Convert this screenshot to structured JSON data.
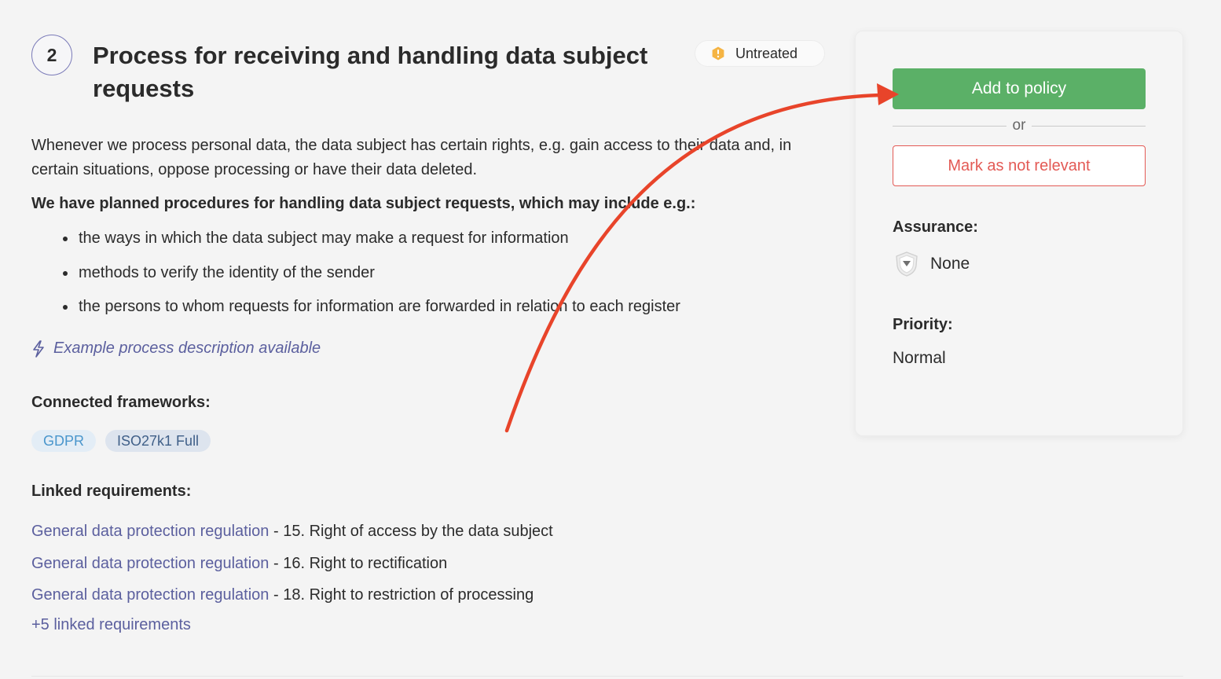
{
  "requirement": {
    "number": "2",
    "title": "Process for receiving and handling data subject requests",
    "status": "Untreated",
    "description": "Whenever we process personal data, the data subject has certain rights, e.g. gain access to their data and, in certain situations, oppose processing or have their data deleted.",
    "description_bold": "We have planned procedures for handling data subject requests, which may include e.g.:",
    "bullets": [
      "the ways in which the data subject may make a request for information",
      "methods to verify the identity of the sender",
      "the persons to whom requests for information are forwarded in relation to each register"
    ],
    "example_link": "Example process description available"
  },
  "frameworks": {
    "heading": "Connected frameworks:",
    "items": [
      "GDPR",
      "ISO27k1 Full"
    ]
  },
  "linked_requirements": {
    "heading": "Linked requirements:",
    "items": [
      {
        "source": "General data protection regulation",
        "separator": " - ",
        "name": "15. Right of access by the data subject"
      },
      {
        "source": "General data protection regulation",
        "separator": " - ",
        "name": "16. Right to rectification"
      },
      {
        "source": "General data protection regulation",
        "separator": " - ",
        "name": "18. Right to restriction of processing"
      }
    ],
    "more_link": "+5 linked requirements"
  },
  "panel": {
    "add_button": "Add to policy",
    "or_text": "or",
    "not_relevant_button": "Mark as not relevant",
    "assurance_label": "Assurance:",
    "assurance_value": "None",
    "priority_label": "Priority:",
    "priority_value": "Normal"
  },
  "colors": {
    "accent_green": "#5bb067",
    "danger_red": "#e35a55",
    "link_purple": "#5b5f9e",
    "warning_orange": "#f5b443",
    "annotation_arrow": "#e8442a"
  },
  "icons": {
    "status": "warning-hexagon-icon",
    "example": "lightning-bolt-icon",
    "assurance": "shield-icon"
  }
}
